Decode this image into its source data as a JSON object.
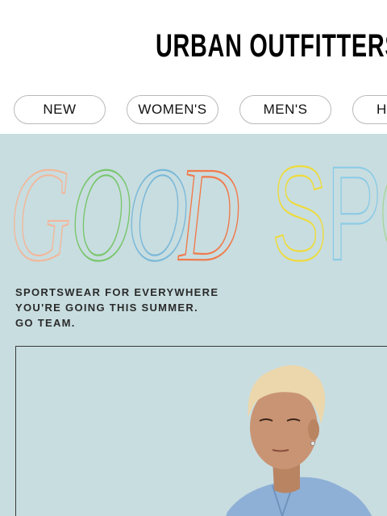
{
  "header": {
    "logo_text": "URBAN OUTFITTERS"
  },
  "nav": {
    "items": [
      {
        "label": "NEW"
      },
      {
        "label": "WOMEN'S"
      },
      {
        "label": "MEN'S"
      },
      {
        "label": "H"
      }
    ]
  },
  "hero": {
    "headline_word_1": "GOOD",
    "headline_word_2": "SPO",
    "letter_colors": [
      "#f2b79a",
      "#79c66c",
      "#7ab8d8",
      "#f07a4a",
      "#eedb3a",
      "#8ccbe6",
      "#a7d69a"
    ],
    "tagline": [
      "SPORTSWEAR FOR EVERYWHERE",
      "YOU'RE GOING THIS SUMMER.",
      "GO TEAM."
    ],
    "background_color": "#c8dde0"
  }
}
